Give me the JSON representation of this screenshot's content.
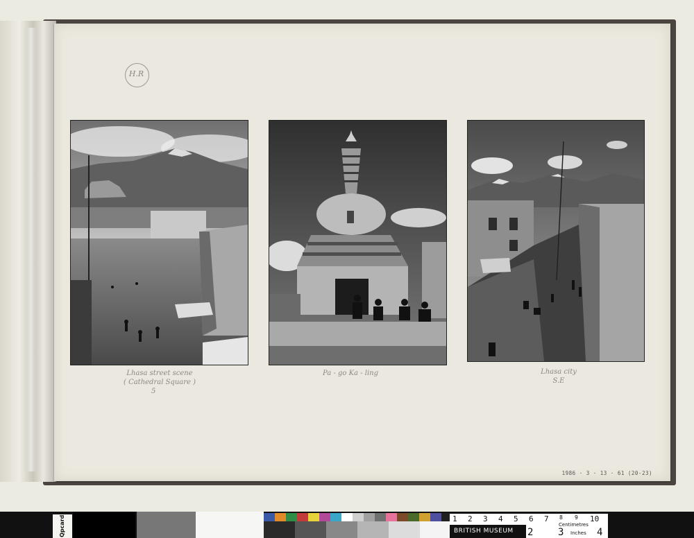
{
  "album_page": {
    "corner_mark": "H.R",
    "accession_number": "1986 · 3 · 13 · 61 (20-23)"
  },
  "photographs": [
    {
      "subject": "street with distant palace and mountains",
      "caption_lines": [
        "Lhasa street scene",
        "( Cathedral Square )",
        "5"
      ]
    },
    {
      "subject": "stupa gate with riders",
      "caption_lines": [
        "Pa - go Ka - ling"
      ]
    },
    {
      "subject": "street looking toward mountains",
      "caption_lines": [
        "Lhasa city",
        "S.E"
      ]
    }
  ],
  "color_target": {
    "side_label": "Qpcard",
    "ruler": {
      "numbers": [
        "1",
        "2",
        "3",
        "4",
        "5",
        "6",
        "7",
        "8",
        "9",
        "10"
      ],
      "centimetres_label": "Centimetres",
      "inches_label": "Inches",
      "inch_numbers": [
        "2",
        "3",
        "4"
      ],
      "museum_label": "BRITISH MUSEUM"
    }
  }
}
